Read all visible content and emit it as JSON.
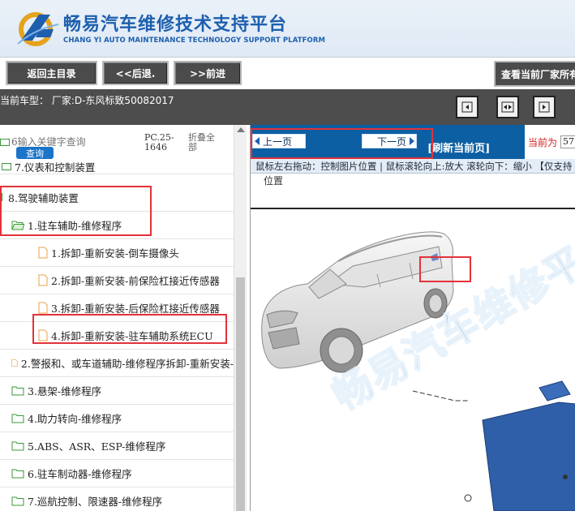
{
  "header": {
    "title_cn": "畅易汽车维修技术支持平台",
    "title_en": "CHANG YI AUTO MAINTENANCE TECHNOLOGY SUPPORT PLATFORM"
  },
  "toolbar": {
    "back_to_catalog": "返回主目录",
    "back": "<<后退.",
    "forward": ">>前进",
    "view_manufacturers": "查看当前厂家所有"
  },
  "model_bar": {
    "current_model": "当前车型： 厂家:D-东风标致50082017"
  },
  "left_panel": {
    "keyword_prefix": "6",
    "keyword_placeholder": "输入关键字查询",
    "search_button": "查询",
    "pc_code": "PC.25-1646",
    "fold_all": "折叠全部",
    "tree": [
      {
        "label": "7.仪表和控制装置",
        "type": "folder"
      },
      {
        "label": "8.驾驶辅助装置",
        "type": "root"
      },
      {
        "label": "1.驻车辅助-维修程序",
        "type": "folder"
      },
      {
        "label": "1.拆卸-重新安装-倒车摄像头",
        "type": "doc"
      },
      {
        "label": "2.拆卸-重新安装-前保险杠接近传感器",
        "type": "doc"
      },
      {
        "label": "3.拆卸-重新安装-后保险杠接近传感器",
        "type": "doc"
      },
      {
        "label": "4.拆卸-重新安装-驻车辅助系统ECU",
        "type": "doc"
      },
      {
        "label": "2.警报和、或车道辅助-维修程序拆卸-重新安装-",
        "type": "doc"
      },
      {
        "label": "3.悬架-维修程序",
        "type": "folder"
      },
      {
        "label": "4.助力转向-维修程序",
        "type": "folder"
      },
      {
        "label": "5.ABS、ASR、ESP-维修程序",
        "type": "folder"
      },
      {
        "label": "6.驻车制动器-维修程序",
        "type": "folder"
      },
      {
        "label": "7.巡航控制、限速器-维修程序",
        "type": "folder"
      }
    ]
  },
  "right_panel": {
    "prev_page": "上一页",
    "next_page": "下一页",
    "refresh": "[刷新当前页]",
    "current_label": "当前为",
    "current_value": "57",
    "hint": "鼠标左右拖动：控制图片位置 | 鼠标滚轮向上:放大  滚轮向下：缩小 【仅支持",
    "caption": "位置",
    "watermark": "畅易汽车维修平"
  },
  "colors": {
    "brand_blue": "#1d5fae",
    "nav_blue": "#0d5fa3",
    "highlight_red": "#e2323a",
    "folder_green": "#3a9a3a",
    "doc_orange": "#e8a24a"
  }
}
